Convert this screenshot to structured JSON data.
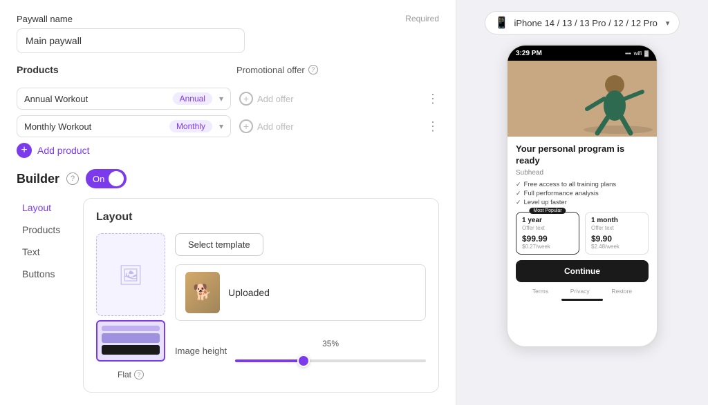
{
  "left": {
    "paywall_name_label": "Paywall name",
    "paywall_name_required": "Required",
    "paywall_name_value": "Main paywall",
    "paywall_name_placeholder": "Main paywall",
    "products_label": "Products",
    "promo_offer_label": "Promotional offer",
    "products": [
      {
        "name": "Annual Workout",
        "badge": "Annual",
        "badge_class": "badge-annual"
      },
      {
        "name": "Monthly Workout",
        "badge": "Monthly",
        "badge_class": "badge-monthly"
      }
    ],
    "add_product_label": "Add product",
    "builder_title": "Builder",
    "builder_toggle_label": "On",
    "nav_items": [
      {
        "label": "Layout",
        "active": true
      },
      {
        "label": "Products",
        "active": false
      },
      {
        "label": "Text",
        "active": false
      },
      {
        "label": "Buttons",
        "active": false
      }
    ],
    "content_title": "Layout",
    "select_template_label": "Select template",
    "uploaded_label": "Uploaded",
    "image_height_label": "Image height",
    "image_height_pct": "35%",
    "image_height_value": 35,
    "flat_label": "Flat"
  },
  "right": {
    "device_label": "iPhone 14 / 13 / 13 Pro / 12 / 12 Pro",
    "status_time": "3:29 PM",
    "phone_headline": "Your personal program is ready",
    "phone_subhead": "Subhead",
    "features": [
      "Free access to all training plans",
      "Full performance analysis",
      "Level up faster"
    ],
    "pricing": [
      {
        "duration": "1 year",
        "offer_text": "Offer text",
        "amount": "$99.99",
        "per_week": "$0.27/week",
        "popular": true,
        "popular_badge": "Most Popular"
      },
      {
        "duration": "1 month",
        "offer_text": "Offer text",
        "amount": "$9.90",
        "per_week": "$2.48/week",
        "popular": false
      }
    ],
    "continue_label": "Continue",
    "footer_links": [
      "Terms",
      "Privacy",
      "Restore"
    ]
  }
}
